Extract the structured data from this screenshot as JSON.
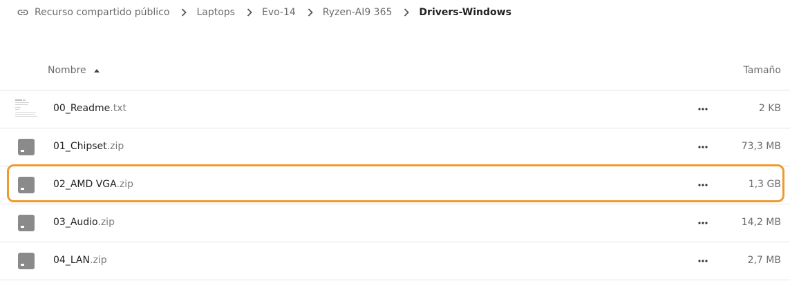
{
  "breadcrumb": {
    "root": "Recurso compartido público",
    "items": [
      "Laptops",
      "Evo-14",
      "Ryzen-AI9 365"
    ],
    "current": "Drivers-Windows"
  },
  "header": {
    "name_label": "Nombre",
    "size_label": "Tamaño"
  },
  "files": [
    {
      "base": "00_Readme",
      "ext": ".txt",
      "size": "2 KB"
    },
    {
      "base": "01_Chipset",
      "ext": ".zip",
      "size": "73,3 MB"
    },
    {
      "base": "02_AMD VGA",
      "ext": ".zip",
      "size": "1,3 GB"
    },
    {
      "base": "03_Audio",
      "ext": ".zip",
      "size": "14,2 MB"
    },
    {
      "base": "04_LAN",
      "ext": ".zip",
      "size": "2,7 MB"
    }
  ],
  "colors": {
    "highlight": "#ef9a2f",
    "archive_icon": "#8a8a8a"
  },
  "icons": {
    "root": "link-icon",
    "separator": "chevron-right-icon",
    "sort": "sort-ascending-icon",
    "archive": "archive-file-icon",
    "text": "text-file-thumbnail",
    "menu": "more-actions-icon"
  }
}
